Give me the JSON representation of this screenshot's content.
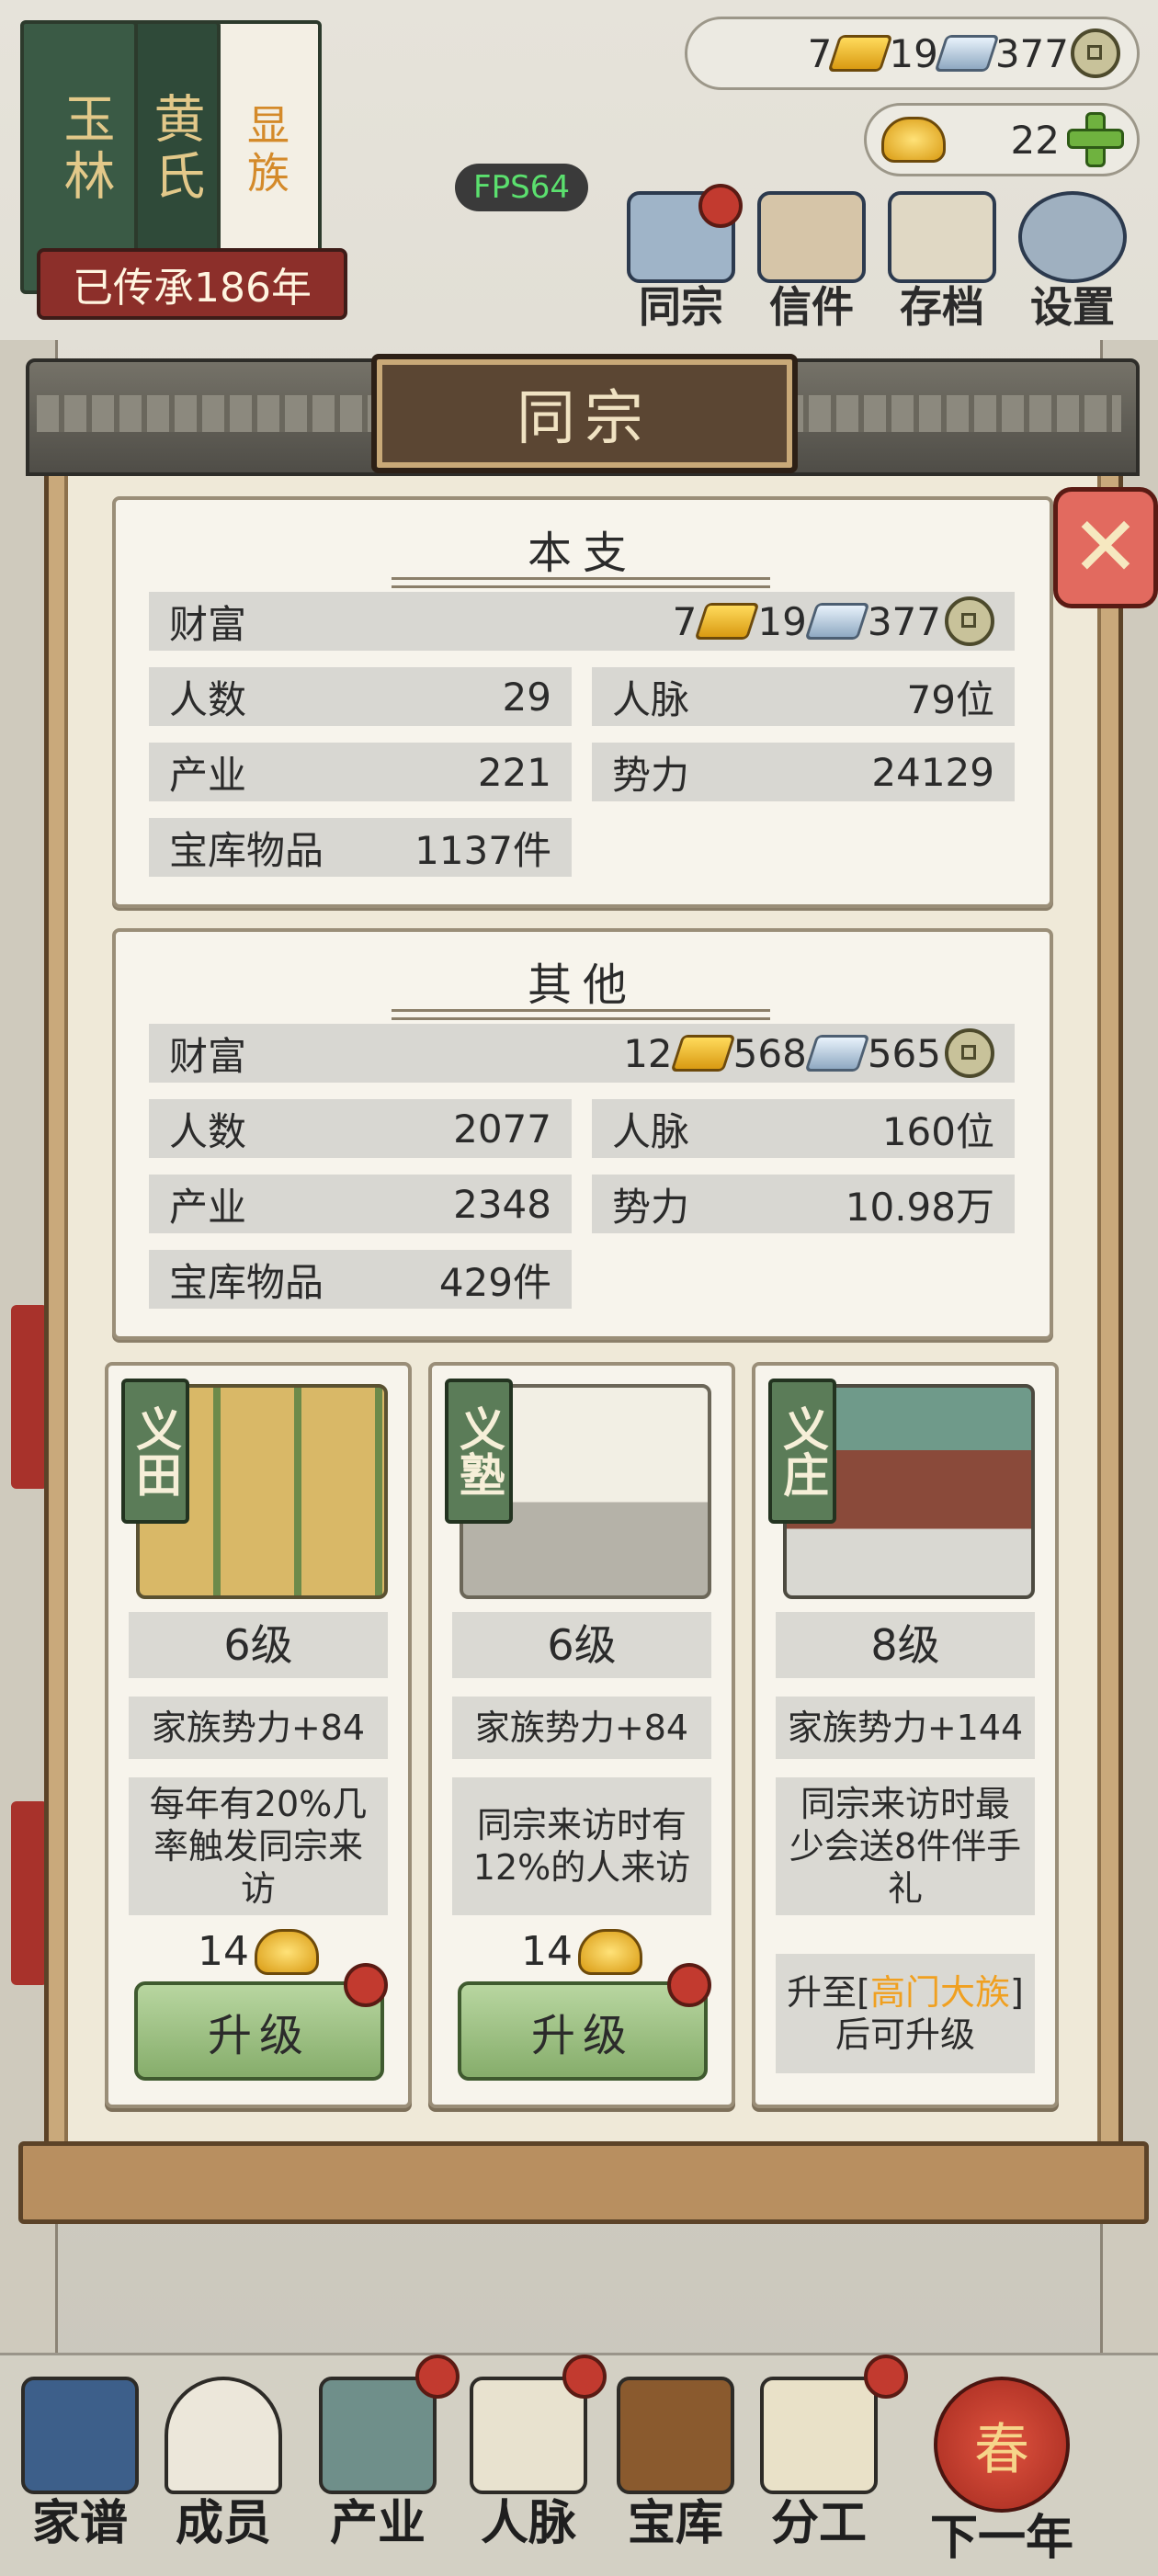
{
  "header": {
    "family_name_main": "玉林",
    "family_name_sub": "黄氏",
    "family_rank": "显族",
    "lineage": "已传承186年",
    "fps": "FPS64"
  },
  "resources": {
    "gold_bars": "7",
    "silver_bars": "19",
    "coins": "377",
    "ingots": "22"
  },
  "top_menu": [
    {
      "label": "同宗",
      "icon": "clan-icon"
    },
    {
      "label": "信件",
      "icon": "letter-icon"
    },
    {
      "label": "存档",
      "icon": "save-icon"
    },
    {
      "label": "设置",
      "icon": "gear-icon"
    }
  ],
  "panel": {
    "title": "同宗"
  },
  "main_branch": {
    "title": "本支",
    "wealth_label": "财富",
    "wealth_gold": "7",
    "wealth_silver": "19",
    "wealth_coins": "377",
    "people_label": "人数",
    "people": "29",
    "network_label": "人脉",
    "network": "79位",
    "industry_label": "产业",
    "industry": "221",
    "power_label": "势力",
    "power": "24129",
    "vault_label": "宝库物品",
    "vault": "1137件"
  },
  "other_branch": {
    "title": "其他",
    "wealth_label": "财富",
    "wealth_gold": "12",
    "wealth_silver": "568",
    "wealth_coins": "565",
    "people_label": "人数",
    "people": "2077",
    "network_label": "人脉",
    "network": "160位",
    "industry_label": "产业",
    "industry": "2348",
    "power_label": "势力",
    "power": "10.98万",
    "vault_label": "宝库物品",
    "vault": "429件"
  },
  "buildings": [
    {
      "tag": "义田",
      "level": "6级",
      "power": "家族势力+84",
      "desc": "每年有20%几率触发同宗来访",
      "cost": "14",
      "upgrade": "升级"
    },
    {
      "tag": "义塾",
      "level": "6级",
      "power": "家族势力+84",
      "desc": "同宗来访时有12%的人来访",
      "cost": "14",
      "upgrade": "升级"
    },
    {
      "tag": "义庄",
      "level": "8级",
      "power": "家族势力+144",
      "desc": "同宗来访时最少会送8件伴手礼",
      "note_prefix": "升至[",
      "note_highlight": "高门大族",
      "note_suffix": "]后可升级"
    }
  ],
  "bottom_nav": [
    {
      "label": "家谱",
      "icon": "genealogy-icon"
    },
    {
      "label": "成员",
      "icon": "members-icon"
    },
    {
      "label": "产业",
      "icon": "industry-icon"
    },
    {
      "label": "人脉",
      "icon": "network-icon"
    },
    {
      "label": "宝库",
      "icon": "treasury-icon"
    },
    {
      "label": "分工",
      "icon": "division-icon"
    },
    {
      "label": "下一年",
      "icon": "next-year-icon",
      "badge": "春"
    }
  ],
  "colors": {
    "accent_red": "#c23a2f",
    "panel_brown": "#5b4633",
    "upgrade_green": "#86ad6b",
    "highlight_orange": "#f0a020"
  }
}
